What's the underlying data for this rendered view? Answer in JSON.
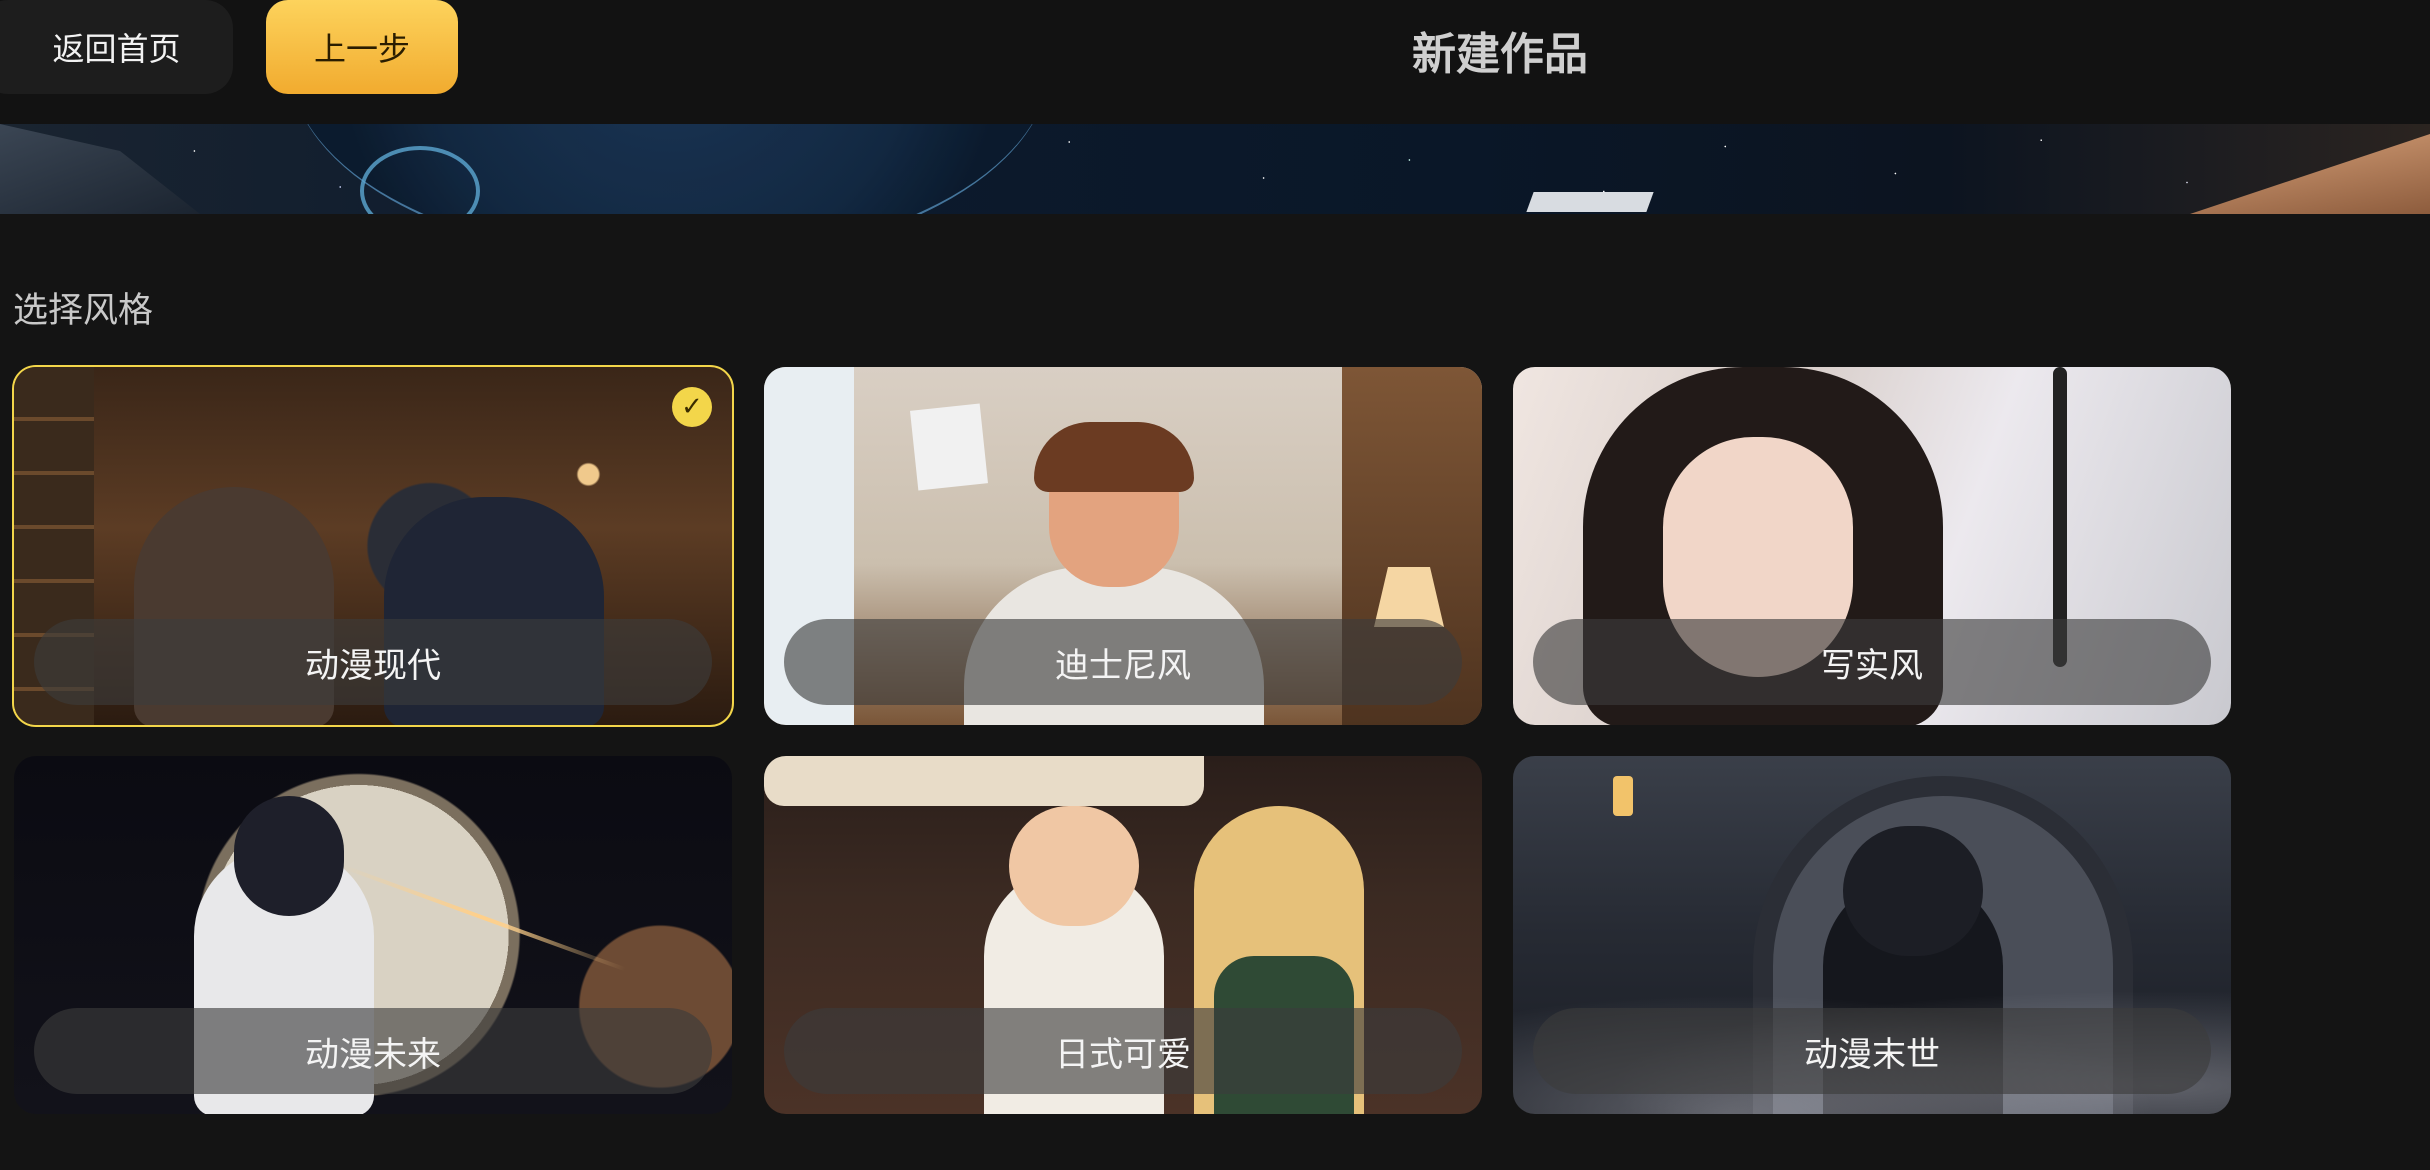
{
  "header": {
    "back_home_label": "返回首页",
    "prev_step_label": "上一步",
    "title": "新建作品"
  },
  "section": {
    "label": "选择风格"
  },
  "styles": [
    {
      "name": "动漫现代",
      "selected": true
    },
    {
      "name": "迪士尼风",
      "selected": false
    },
    {
      "name": "写实风",
      "selected": false
    },
    {
      "name": "动漫未来",
      "selected": false
    },
    {
      "name": "日式可爱",
      "selected": false
    },
    {
      "name": "动漫末世",
      "selected": false
    }
  ],
  "colors": {
    "accent": "#f3d64a",
    "button_gradient_top": "#fdd35c",
    "button_gradient_bottom": "#f1ab2f",
    "background": "#141414"
  },
  "icons": {
    "selected_check": "✓"
  }
}
